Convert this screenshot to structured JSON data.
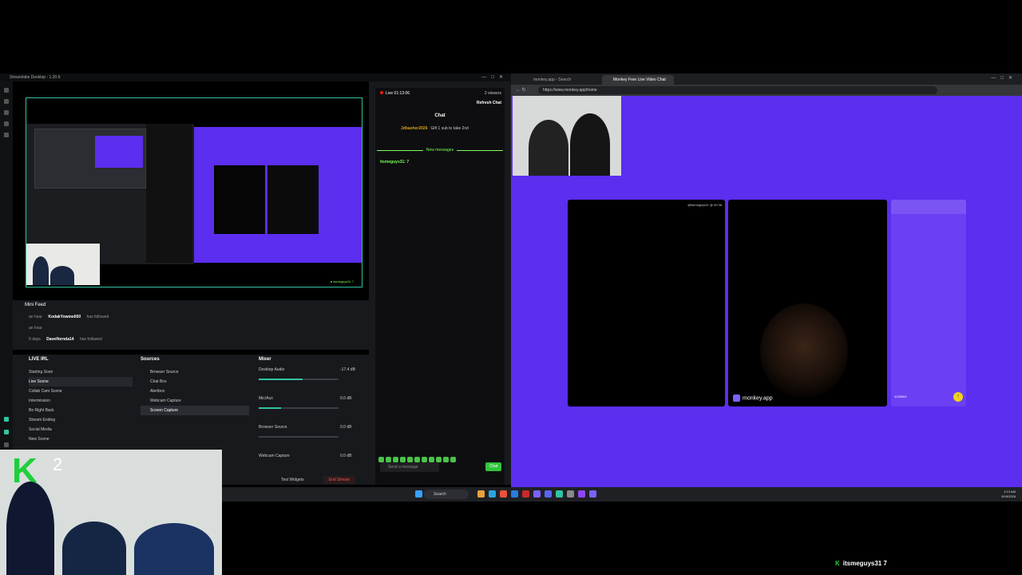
{
  "streamlabs": {
    "title": "Streamlabs Desktop - 1.20.9",
    "preview_badge": "● itsmeguys31 7",
    "mini_feed": {
      "title": "Mini Feed",
      "rows": [
        {
          "time": "an hour",
          "user": "KodakYowmeli00",
          "action": "has followed"
        },
        {
          "time": "an hour",
          "user": "",
          "action": ""
        },
        {
          "time": "6 days",
          "user": "Davelfornda14",
          "action": "has followed"
        }
      ]
    },
    "scenes_title": "LIVE IRL",
    "scenes": [
      "Starting Soon",
      "Live Scene",
      "Collab Cam Scene",
      "Intermission",
      "Be Right Back",
      "Stream Ending",
      "Social Media",
      "New Scene"
    ],
    "active_scene_index": 1,
    "sources_title": "Sources",
    "sources": [
      "Browser Source",
      "Chat Box",
      "Alertbox",
      "Webcam Capture",
      "Screen Capture"
    ],
    "active_source_index": 4,
    "mixer_title": "Mixer",
    "mixer": [
      {
        "name": "Desktop Audio",
        "db": "-17.4 dB",
        "level": 0.55
      },
      {
        "name": "Mic/Aux",
        "db": "0.0 dB",
        "level": 0.28
      },
      {
        "name": "Browser Source",
        "db": "0.0 dB",
        "level": 0
      },
      {
        "name": "Webcam Capture",
        "db": "0.0 dB",
        "level": 0
      }
    ],
    "test_widgets": "Test Widgets",
    "end_stream": "End Stream"
  },
  "chat": {
    "live_time": "Live 01:13:06",
    "viewers": "2 viewers",
    "refresh": "Refresh Chat",
    "title": "Chat",
    "gift_user": "Jdbasher2026",
    "gift_text": "Gift 1 sub to take 2nd",
    "new_messages": "New messages",
    "message1": "itsmeguys31: 7",
    "input_placeholder": "Send a message",
    "send": "Chat"
  },
  "browser": {
    "tabs": [
      "monkey.app - Search",
      "Monkey Free Live Video Chat"
    ],
    "url": "https://www.monkey.app/home",
    "video1_caption": "@itsmeguys31 @ 00:38",
    "watermark": "monkey.app",
    "code": "4128004"
  },
  "taskbar": {
    "search": "Search",
    "time": "4:13 AM",
    "date": "9/18/2026"
  },
  "overlay_sub": "itsmeguys31  7",
  "colors": {
    "accent": "#31c3a2",
    "twitch_green": "#7cff5a",
    "monkey_purple": "#5b2ef0"
  }
}
